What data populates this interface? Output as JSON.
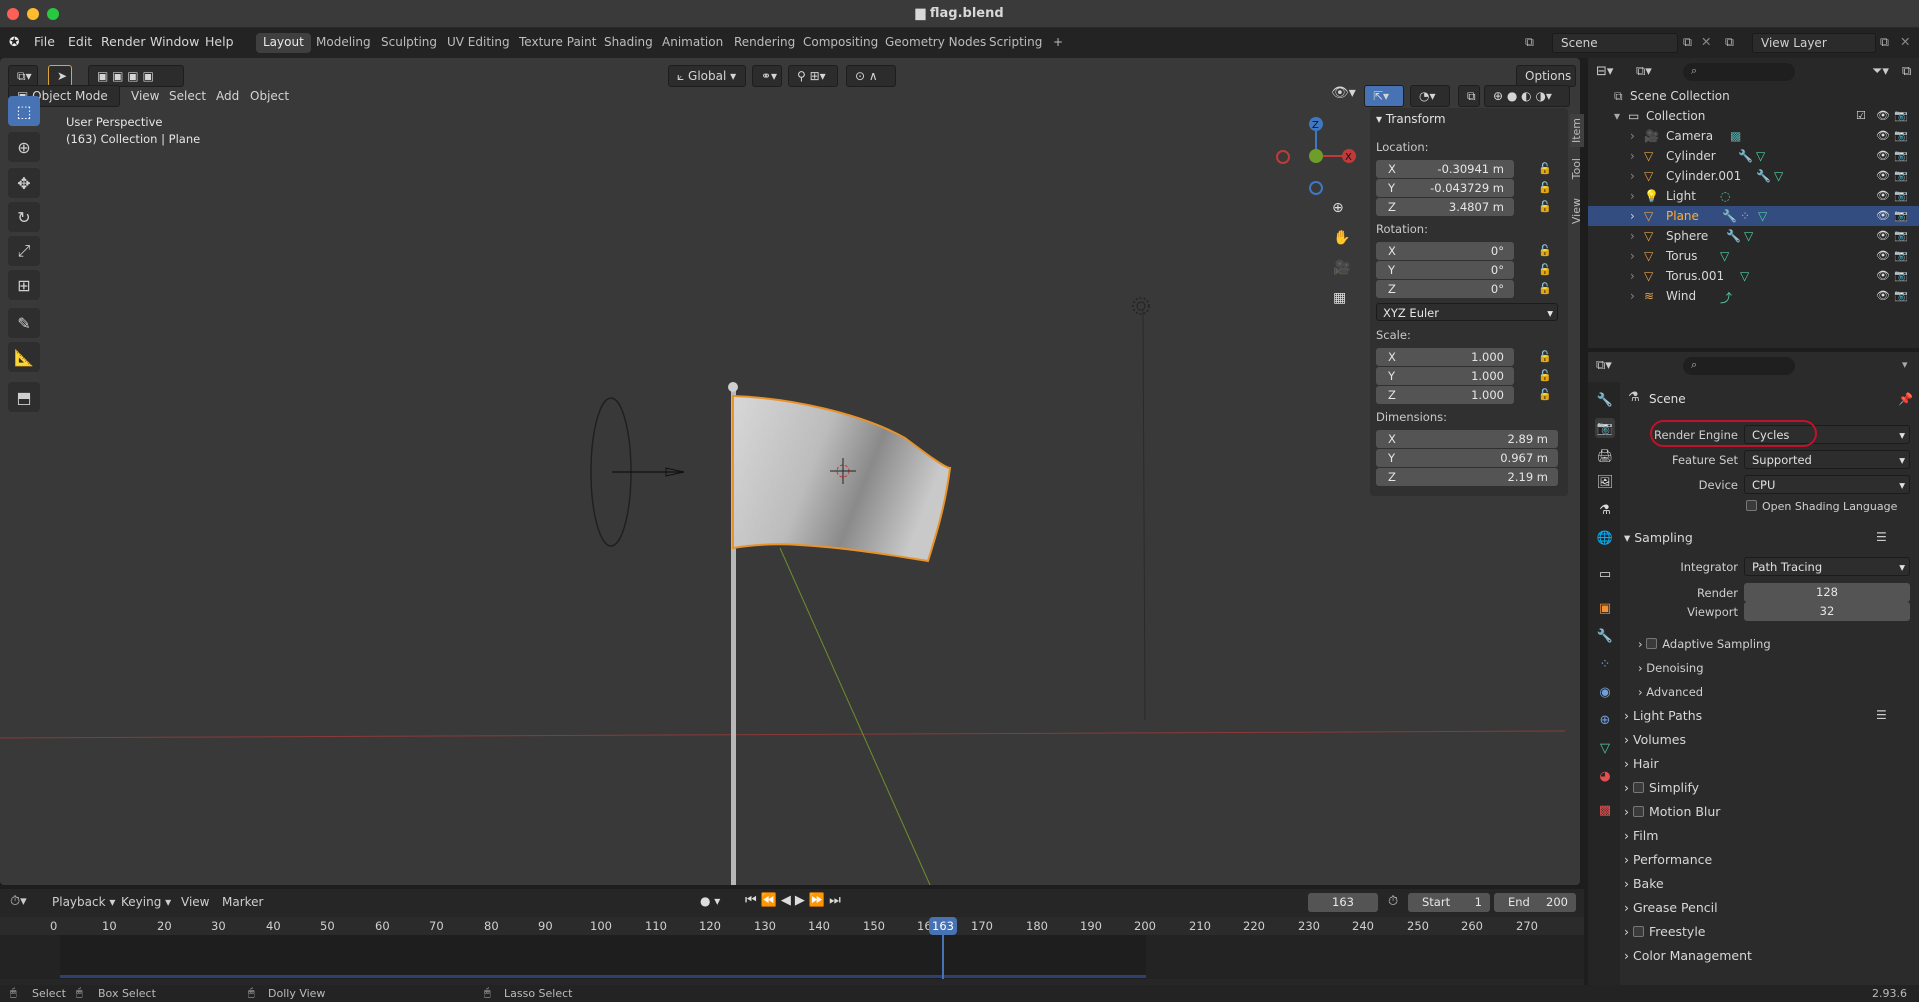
{
  "window": {
    "title": "flag.blend"
  },
  "menu": {
    "items": [
      "File",
      "Edit",
      "Render",
      "Window",
      "Help"
    ],
    "workspaces": [
      "Layout",
      "Modeling",
      "Sculpting",
      "UV Editing",
      "Texture Paint",
      "Shading",
      "Animation",
      "Rendering",
      "Compositing",
      "Geometry Nodes",
      "Scripting"
    ],
    "active_workspace": "Layout",
    "add_tab": "+",
    "scene": "Scene",
    "view_layer": "View Layer"
  },
  "viewport": {
    "mode": "Object Mode",
    "menus": [
      "View",
      "Select",
      "Add",
      "Object"
    ],
    "orientation": "Global",
    "options": "Options",
    "perspective_label": "User Perspective",
    "collection_label": "(163) Collection | Plane"
  },
  "npanel": {
    "tabs": [
      "Item",
      "Tool",
      "View"
    ],
    "header": "Transform",
    "location_label": "Location:",
    "location": [
      {
        "axis": "X",
        "value": "-0.30941 m"
      },
      {
        "axis": "Y",
        "value": "-0.043729 m"
      },
      {
        "axis": "Z",
        "value": "3.4807 m"
      }
    ],
    "rotation_label": "Rotation:",
    "rotation": [
      {
        "axis": "X",
        "value": "0°"
      },
      {
        "axis": "Y",
        "value": "0°"
      },
      {
        "axis": "Z",
        "value": "0°"
      }
    ],
    "rotation_mode": "XYZ Euler",
    "scale_label": "Scale:",
    "scale": [
      {
        "axis": "X",
        "value": "1.000"
      },
      {
        "axis": "Y",
        "value": "1.000"
      },
      {
        "axis": "Z",
        "value": "1.000"
      }
    ],
    "dimensions_label": "Dimensions:",
    "dimensions": [
      {
        "axis": "X",
        "value": "2.89 m"
      },
      {
        "axis": "Y",
        "value": "0.967 m"
      },
      {
        "axis": "Z",
        "value": "2.19 m"
      }
    ]
  },
  "outliner": {
    "scene_collection": "Scene Collection",
    "collection": "Collection",
    "items": [
      "Camera",
      "Cylinder",
      "Cylinder.001",
      "Light",
      "Plane",
      "Sphere",
      "Torus",
      "Torus.001",
      "Wind"
    ],
    "selected": "Plane"
  },
  "properties": {
    "context": "Scene",
    "render_engine_label": "Render Engine",
    "render_engine": "Cycles",
    "feature_set_label": "Feature Set",
    "feature_set": "Supported",
    "device_label": "Device",
    "device": "CPU",
    "osl_label": "Open Shading Language",
    "sampling": "Sampling",
    "integrator_label": "Integrator",
    "integrator": "Path Tracing",
    "render_label": "Render",
    "render_samples": "128",
    "viewport_label": "Viewport",
    "viewport_samples": "32",
    "adaptive_sampling": "Adaptive Sampling",
    "denoising": "Denoising",
    "advanced": "Advanced",
    "sections": [
      "Light Paths",
      "Volumes",
      "Hair",
      "Simplify",
      "Motion Blur",
      "Film",
      "Performance",
      "Bake",
      "Grease Pencil",
      "Freestyle",
      "Color Management"
    ]
  },
  "timeline": {
    "menus": [
      "Playback",
      "Keying",
      "View",
      "Marker"
    ],
    "current_frame": "163",
    "start_label": "Start",
    "start": "1",
    "end_label": "End",
    "end": "200",
    "ticks": [
      "0",
      "10",
      "20",
      "30",
      "40",
      "50",
      "60",
      "70",
      "80",
      "90",
      "100",
      "110",
      "120",
      "130",
      "140",
      "150",
      "160",
      "170",
      "180",
      "190",
      "200",
      "210",
      "220",
      "230",
      "240",
      "250",
      "260",
      "270"
    ]
  },
  "status": {
    "select": "Select",
    "box_select": "Box Select",
    "dolly_view": "Dolly View",
    "lasso_select": "Lasso Select",
    "version": "2.93.6"
  },
  "colors": {
    "accent": "#4772b3",
    "selection_outline": "#e8932a",
    "annotation": "#c0122a"
  }
}
